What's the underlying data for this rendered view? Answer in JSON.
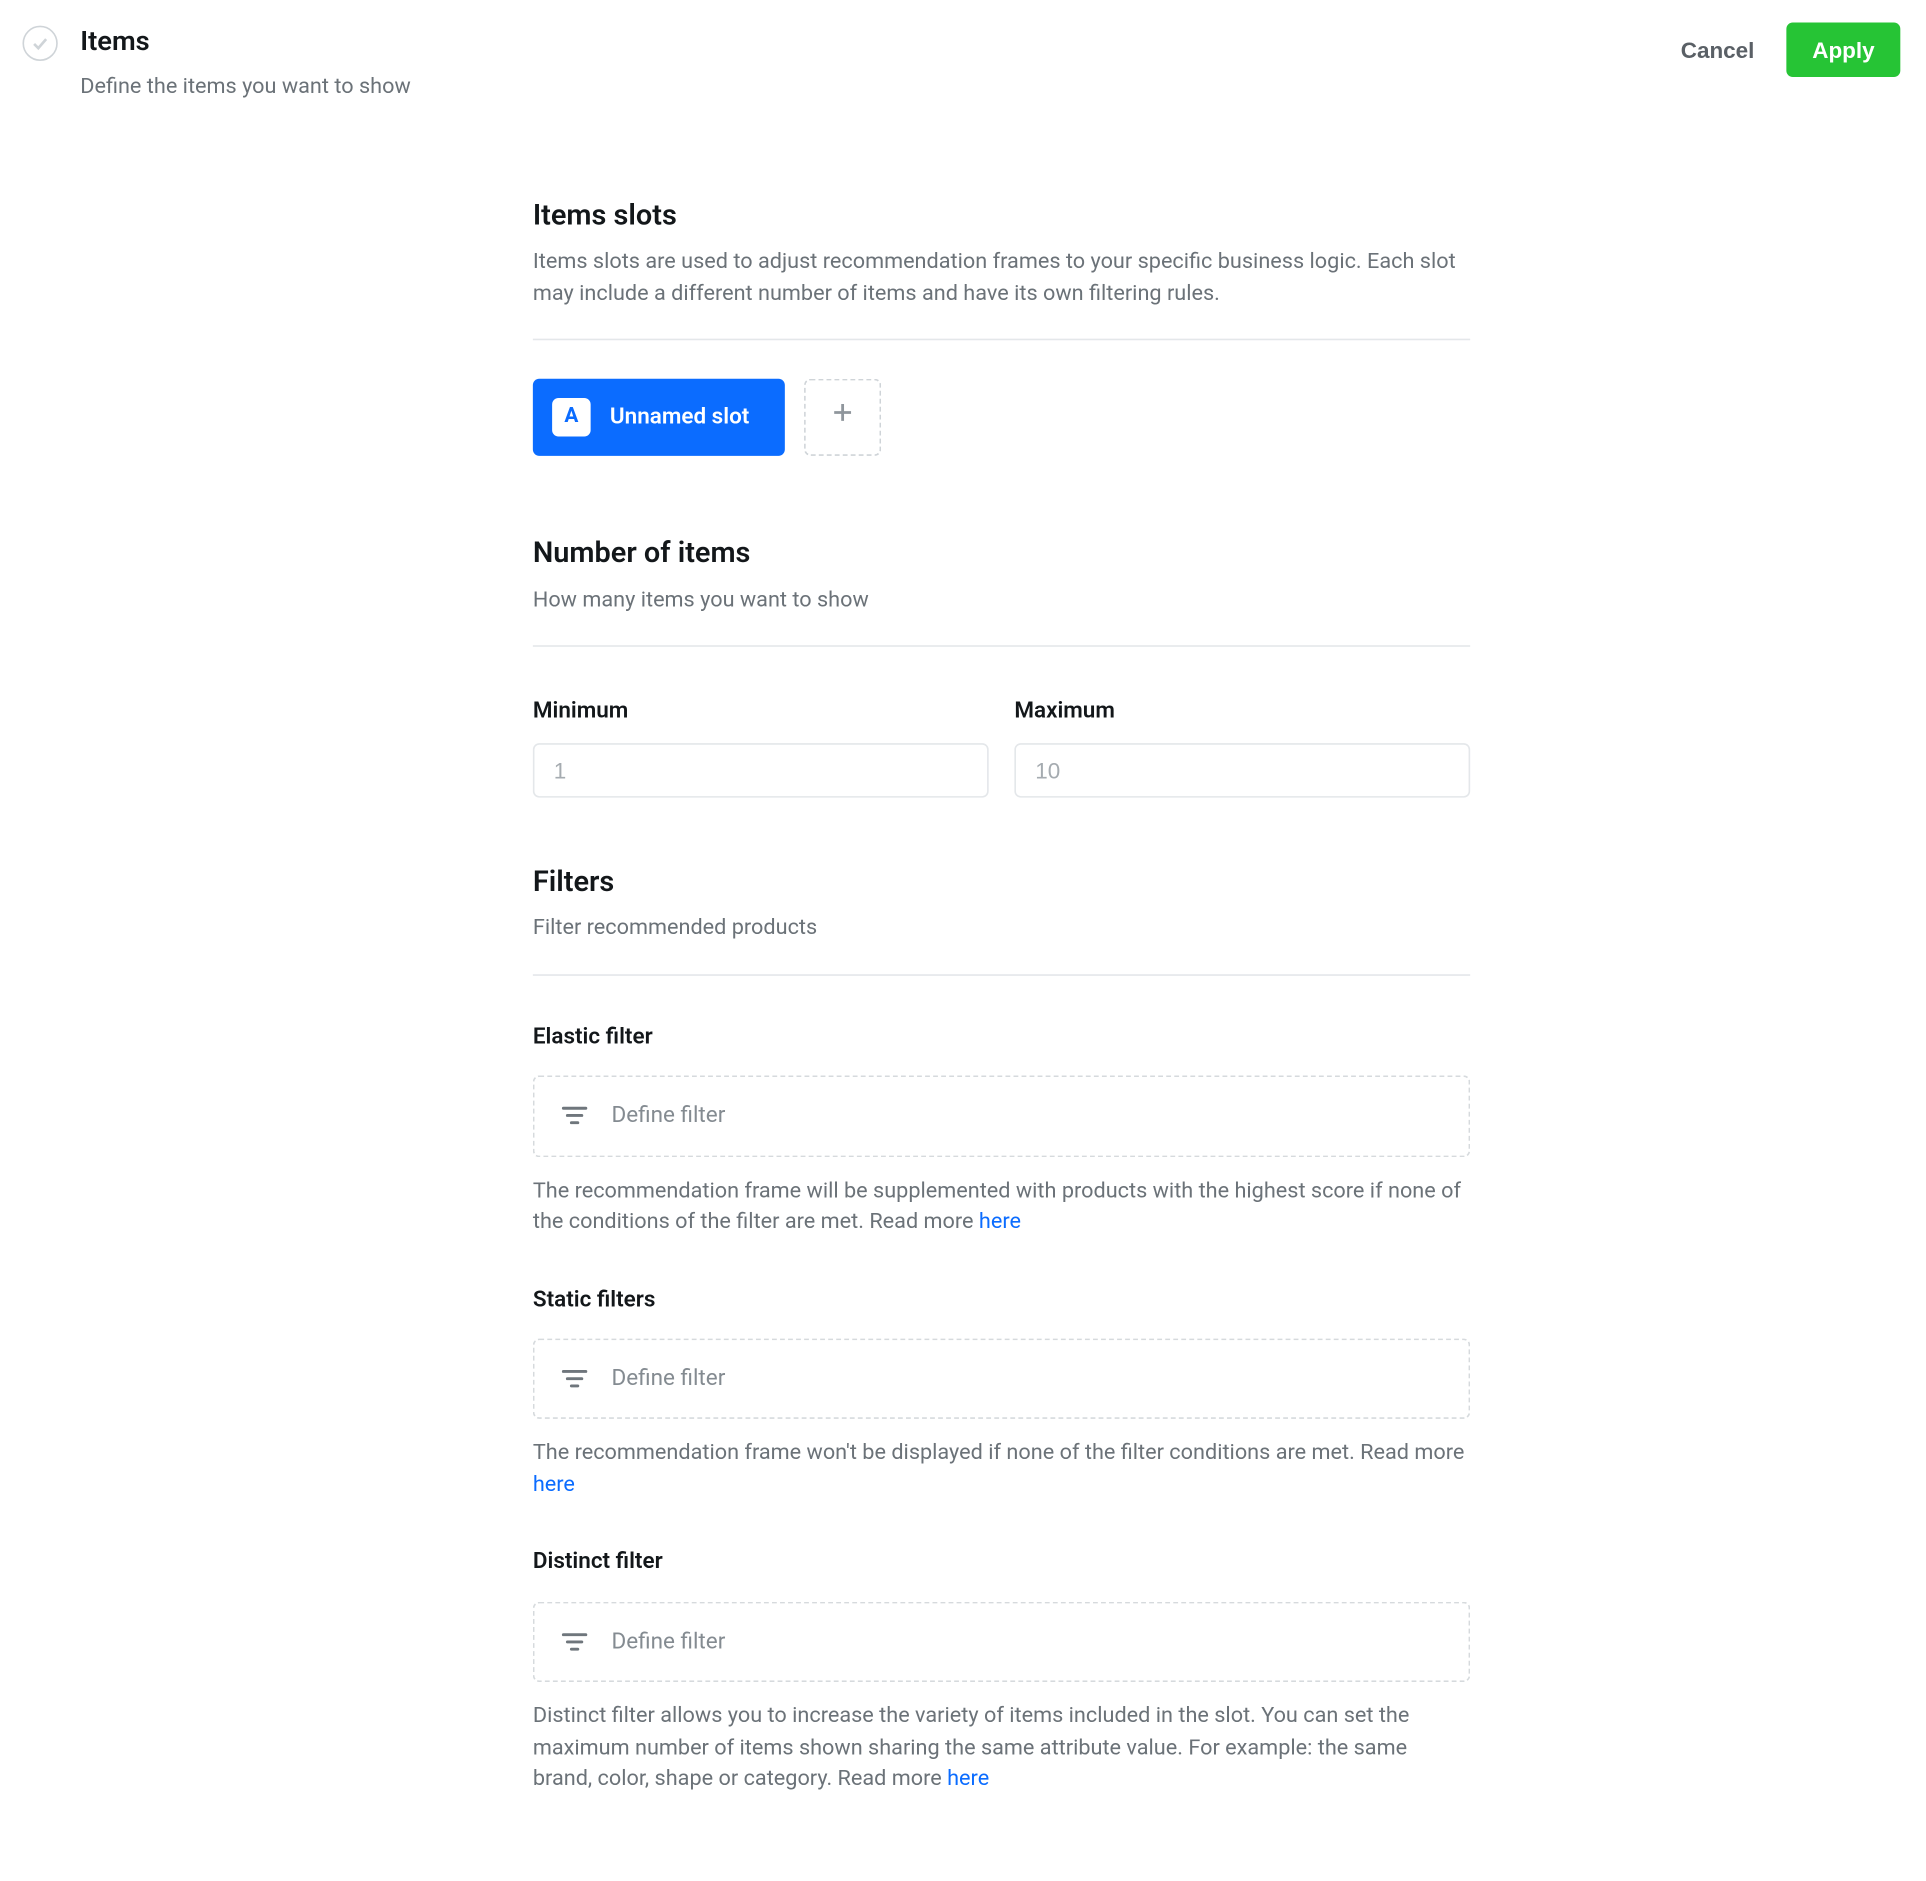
{
  "header": {
    "title": "Items",
    "subtitle": "Define the items you want to show",
    "cancel": "Cancel",
    "apply": "Apply"
  },
  "slots_section": {
    "title": "Items slots",
    "subtitle": "Items slots are used to adjust recommendation frames to your specific business logic. Each slot may include a different number of items and have its own filtering rules."
  },
  "slots": {
    "active": {
      "badge": "A",
      "name": "Unnamed slot"
    }
  },
  "number_section": {
    "title": "Number of items",
    "subtitle": "How many items you want to show",
    "min_label": "Minimum",
    "max_label": "Maximum",
    "min_placeholder": "1",
    "max_placeholder": "10",
    "min_value": "",
    "max_value": ""
  },
  "filters_section": {
    "title": "Filters",
    "subtitle": "Filter recommended products"
  },
  "filters": {
    "define_label": "Define filter",
    "elastic": {
      "label": "Elastic filter",
      "help_pre": "The recommendation frame will be supplemented with products with the highest score if none of the conditions of the filter are met. Read more ",
      "help_link": "here"
    },
    "static": {
      "label": "Static filters",
      "help_pre": "The recommendation frame won't be displayed if none of the filter conditions are met. Read more ",
      "help_link": "here"
    },
    "distinct": {
      "label": "Distinct filter",
      "help_pre": "Distinct filter allows you to increase the variety of items included in the slot. You can set the maximum number of items shown sharing the same attribute value. For example: the same brand, color, shape or category. Read more ",
      "help_link": "here"
    }
  }
}
